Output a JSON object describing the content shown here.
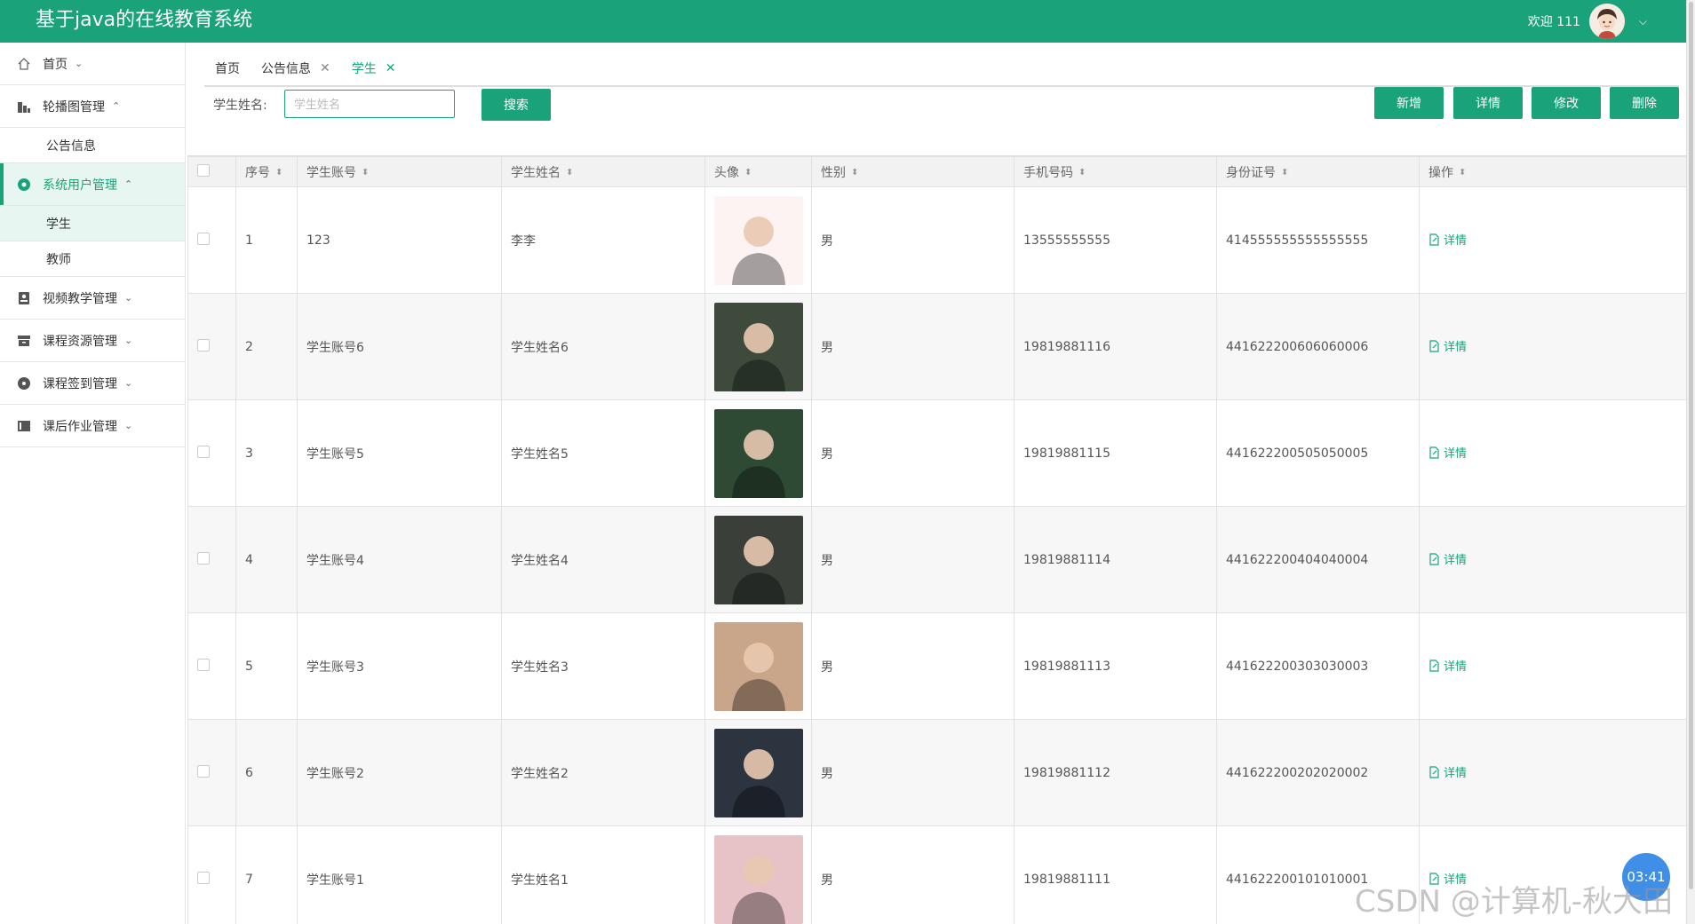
{
  "header": {
    "title": "基于java的在线教育系统",
    "welcome": "欢迎 111"
  },
  "sidebar": {
    "items": [
      {
        "label": "首页",
        "icon": "home-icon",
        "arrow": "⌄"
      },
      {
        "label": "轮播图管理",
        "icon": "building-icon",
        "arrow": "⌃"
      },
      {
        "label": "公告信息",
        "sub": true
      },
      {
        "label": "系统用户管理",
        "icon": "circle-icon",
        "arrow": "⌃",
        "active": true
      },
      {
        "label": "学生",
        "sub": true,
        "active": true
      },
      {
        "label": "教师",
        "sub": true
      },
      {
        "label": "视频教学管理",
        "icon": "video-icon",
        "arrow": "⌄"
      },
      {
        "label": "课程资源管理",
        "icon": "archive-icon",
        "arrow": "⌄"
      },
      {
        "label": "课程签到管理",
        "icon": "disc-icon",
        "arrow": "⌄"
      },
      {
        "label": "课后作业管理",
        "icon": "book-icon",
        "arrow": "⌄"
      }
    ]
  },
  "tabs": [
    {
      "label": "首页",
      "closable": false
    },
    {
      "label": "公告信息",
      "closable": true
    },
    {
      "label": "学生",
      "closable": true,
      "active": true
    }
  ],
  "search": {
    "label": "学生姓名:",
    "placeholder": "学生姓名",
    "button": "搜索"
  },
  "toolbar": {
    "add": "新增",
    "detail": "详情",
    "edit": "修改",
    "delete": "删除"
  },
  "table": {
    "columns": [
      "序号",
      "学生账号",
      "学生姓名",
      "头像",
      "性别",
      "手机号码",
      "身份证号",
      "操作"
    ],
    "op_label": "详情",
    "rows": [
      {
        "no": "1",
        "account": "123",
        "name": "李李",
        "gender": "男",
        "phone": "13555555555",
        "id_card": "414555555555555555",
        "avatar_color": "#fdf3f3"
      },
      {
        "no": "2",
        "account": "学生账号6",
        "name": "学生姓名6",
        "gender": "男",
        "phone": "19819881116",
        "id_card": "441622200606060006",
        "avatar_color": "#3d4a3c"
      },
      {
        "no": "3",
        "account": "学生账号5",
        "name": "学生姓名5",
        "gender": "男",
        "phone": "19819881115",
        "id_card": "441622200505050005",
        "avatar_color": "#2e4a35"
      },
      {
        "no": "4",
        "account": "学生账号4",
        "name": "学生姓名4",
        "gender": "男",
        "phone": "19819881114",
        "id_card": "441622200404040004",
        "avatar_color": "#3a3f3a"
      },
      {
        "no": "5",
        "account": "学生账号3",
        "name": "学生姓名3",
        "gender": "男",
        "phone": "19819881113",
        "id_card": "441622200303030003",
        "avatar_color": "#c9a58a"
      },
      {
        "no": "6",
        "account": "学生账号2",
        "name": "学生姓名2",
        "gender": "男",
        "phone": "19819881112",
        "id_card": "441622200202020002",
        "avatar_color": "#2c3440"
      },
      {
        "no": "7",
        "account": "学生账号1",
        "name": "学生姓名1",
        "gender": "男",
        "phone": "19819881111",
        "id_card": "441622200101010001",
        "avatar_color": "#e7c2c6"
      }
    ]
  },
  "timer": "03:41",
  "watermark": "CSDN @计算机-秋大田",
  "colors": {
    "primary": "#1aa27a"
  }
}
